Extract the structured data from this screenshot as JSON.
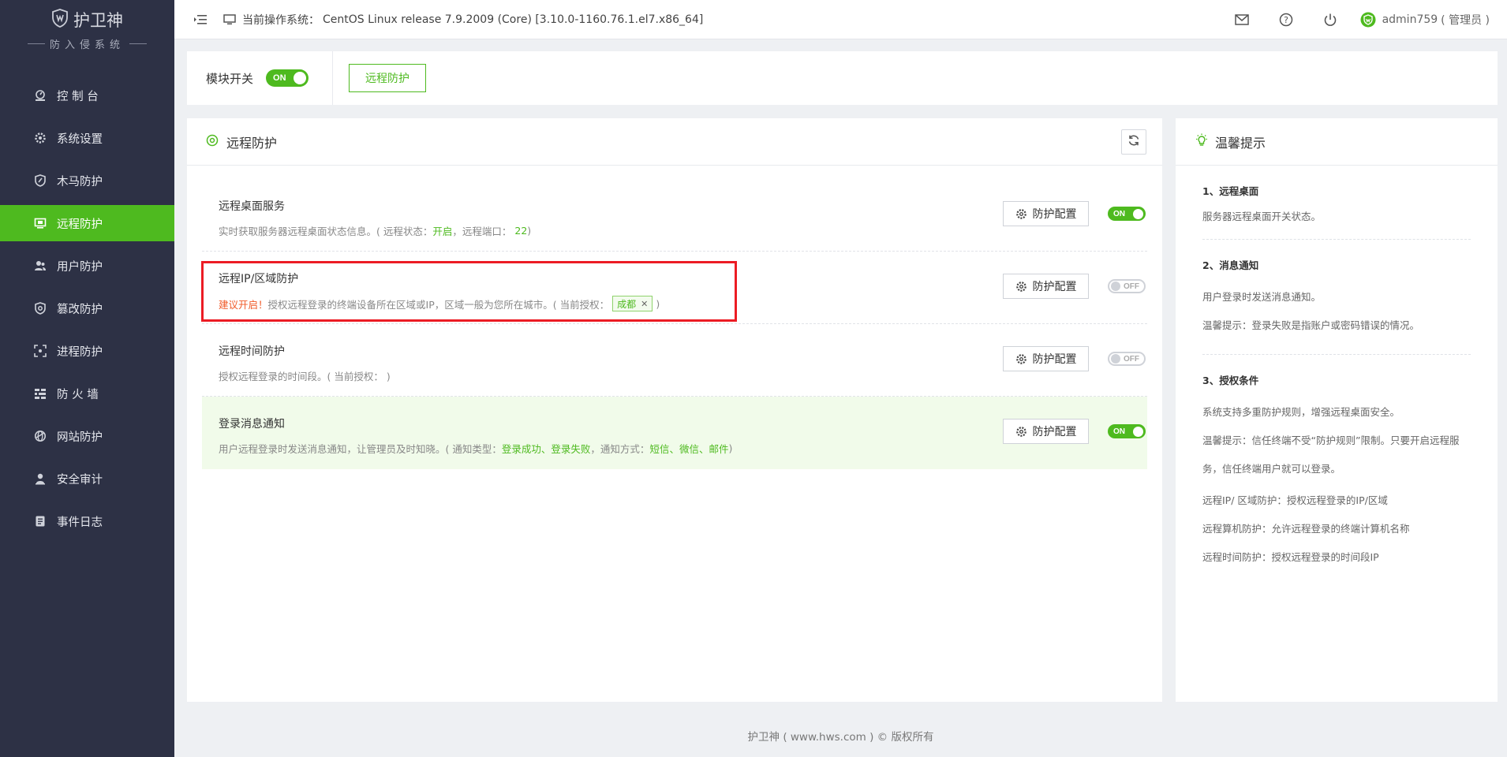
{
  "brand": {
    "name": "护卫神",
    "subtitle": "防入侵系统"
  },
  "sidebar": {
    "items": [
      {
        "label": "控 制 台",
        "icon": "dashboard-icon"
      },
      {
        "label": "系统设置",
        "icon": "gear-icon"
      },
      {
        "label": "木马防护",
        "icon": "shield-icon"
      },
      {
        "label": "远程防护",
        "icon": "monitor-icon",
        "active": true
      },
      {
        "label": "用户防护",
        "icon": "users-icon"
      },
      {
        "label": "篡改防护",
        "icon": "shield-gear-icon"
      },
      {
        "label": "进程防护",
        "icon": "scan-icon"
      },
      {
        "label": "防 火 墙",
        "icon": "firewall-icon"
      },
      {
        "label": "网站防护",
        "icon": "globe-icon"
      },
      {
        "label": "安全审计",
        "icon": "audit-icon"
      },
      {
        "label": "事件日志",
        "icon": "log-icon"
      }
    ]
  },
  "topbar": {
    "sys_label": "当前操作系统：",
    "sys_value": "CentOS Linux release 7.9.2009 (Core) [3.10.0-1160.76.1.el7.x86_64]",
    "user": "admin759",
    "role": "( 管理员 )"
  },
  "module": {
    "switch_label": "模块开关",
    "switch_state": "ON",
    "tab_label": "远程防护"
  },
  "main": {
    "title": "远程防护",
    "config_label": "防护配置",
    "rows": {
      "desktop": {
        "title": "远程桌面服务",
        "desc_prefix": "实时获取服务器远程桌面状态信息。( 远程状态：",
        "status": "开启",
        "desc_mid": "，远程端口：",
        "port": "22",
        "desc_suffix": " )",
        "toggle": "ON"
      },
      "ip": {
        "title": "远程IP/区域防护",
        "warn": "建议开启！",
        "desc": "授权远程登录的终端设备所在区域或IP，区域一般为您所在城市。( 当前授权：",
        "tag": "成都",
        "desc_suffix": " )",
        "toggle": "OFF"
      },
      "time": {
        "title": "远程时间防护",
        "desc": "授权远程登录的时间段。( 当前授权： )",
        "toggle": "OFF"
      },
      "notify": {
        "title": "登录消息通知",
        "desc_prefix": "用户远程登录时发送消息通知，让管理员及时知晓。( 通知类型：",
        "type1": "登录成功",
        "sep1": "、",
        "type2": "登录失败",
        "desc_mid": "，通知方式：",
        "way1": "短信",
        "sep2": "、",
        "way2": "微信",
        "sep3": "、",
        "way3": "邮件",
        "desc_suffix": " )",
        "toggle": "ON"
      }
    }
  },
  "tips": {
    "title": "温馨提示",
    "s1": {
      "heading": "1、远程桌面",
      "p1": "服务器远程桌面开关状态。"
    },
    "s2": {
      "heading": "2、消息通知",
      "p1": "用户登录时发送消息通知。",
      "p2": "温馨提示：登录失败是指账户或密码错误的情况。"
    },
    "s3": {
      "heading": "3、授权条件",
      "p1": "系统支持多重防护规则，增强远程桌面安全。",
      "p2": "温馨提示：信任终端不受“防护规则”限制。只要开启远程服务，信任终端用户就可以登录。",
      "p3": "远程IP/ 区域防护：授权远程登录的IP/区域",
      "p4": "远程算机防护：允许远程登录的终端计算机名称",
      "p5": "远程时间防护：授权远程登录的时间段IP"
    }
  },
  "footer": {
    "text": "护卫神 ( www.hws.com ) © 版权所有"
  },
  "colors": {
    "accent": "#4eba1f",
    "sidebar_bg": "#2d3145",
    "warn": "#f05a28",
    "highlight_box": "#ec1c24"
  }
}
